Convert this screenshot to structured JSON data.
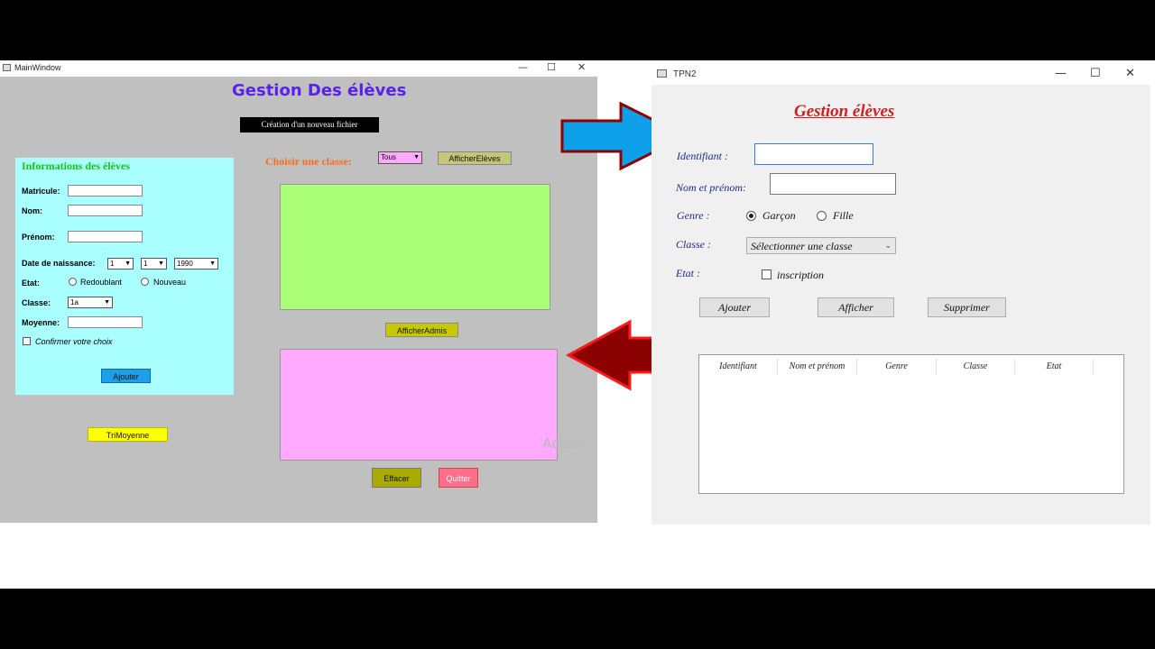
{
  "left_window": {
    "title": "MainWindow",
    "controls": {
      "minimize": "—",
      "maximize": "☐",
      "close": "✕"
    },
    "heading": "Gestion Des élèves",
    "new_file_button": "Création d'un nouveau fichier",
    "info_panel": {
      "title": "Informations des élèves",
      "matricule_label": "Matricule:",
      "nom_label": "Nom:",
      "prenom_label": "Prénom:",
      "birth_label": "Date de naissance:",
      "birth_day": "1",
      "birth_month": "1",
      "birth_year": "1990",
      "etat_label": "Etat:",
      "etat_options": [
        "Redoublant",
        "Nouveau"
      ],
      "classe_label": "Classe:",
      "classe_value": "1a",
      "moyenne_label": "Moyenne:",
      "confirm_label": "Confirmer votre choix",
      "add_button": "Ajouter"
    },
    "tri_button": "TriMoyenne",
    "choose_class_label": "Choisir une classe:",
    "class_filter_value": "Tous",
    "show_students_button": "AfficherElèves",
    "show_admitted_button": "AfficherAdmis",
    "clear_button": "Effacer",
    "quit_button": "Quitter",
    "watermark": "Activer '"
  },
  "right_window": {
    "title": "TPN2",
    "controls": {
      "minimize": "—",
      "maximize": "☐",
      "close": "✕"
    },
    "heading": "Gestion élèves",
    "identifiant_label": "Identifiant :",
    "nom_prenom_label": "Nom et prénom:",
    "genre_label": "Genre :",
    "genre_options": [
      "Garçon",
      "Fille"
    ],
    "genre_selected": "Garçon",
    "classe_label": "Classe :",
    "classe_placeholder": "Sélectionner une classe",
    "etat_label": "Etat :",
    "inscription_label": "inscription",
    "buttons": {
      "add": "Ajouter",
      "show": "Afficher",
      "delete": "Supprimer"
    },
    "table_headers": [
      "Identifiant",
      "Nom et prénom",
      "Genre",
      "Classe",
      "Etat"
    ]
  },
  "colors": {
    "blue_arrow": "#0da0e8",
    "red_arrow": "#8b0000",
    "info_panel": "#aaffff",
    "green_box": "#aaff77",
    "pink_box": "#ffaaff"
  }
}
